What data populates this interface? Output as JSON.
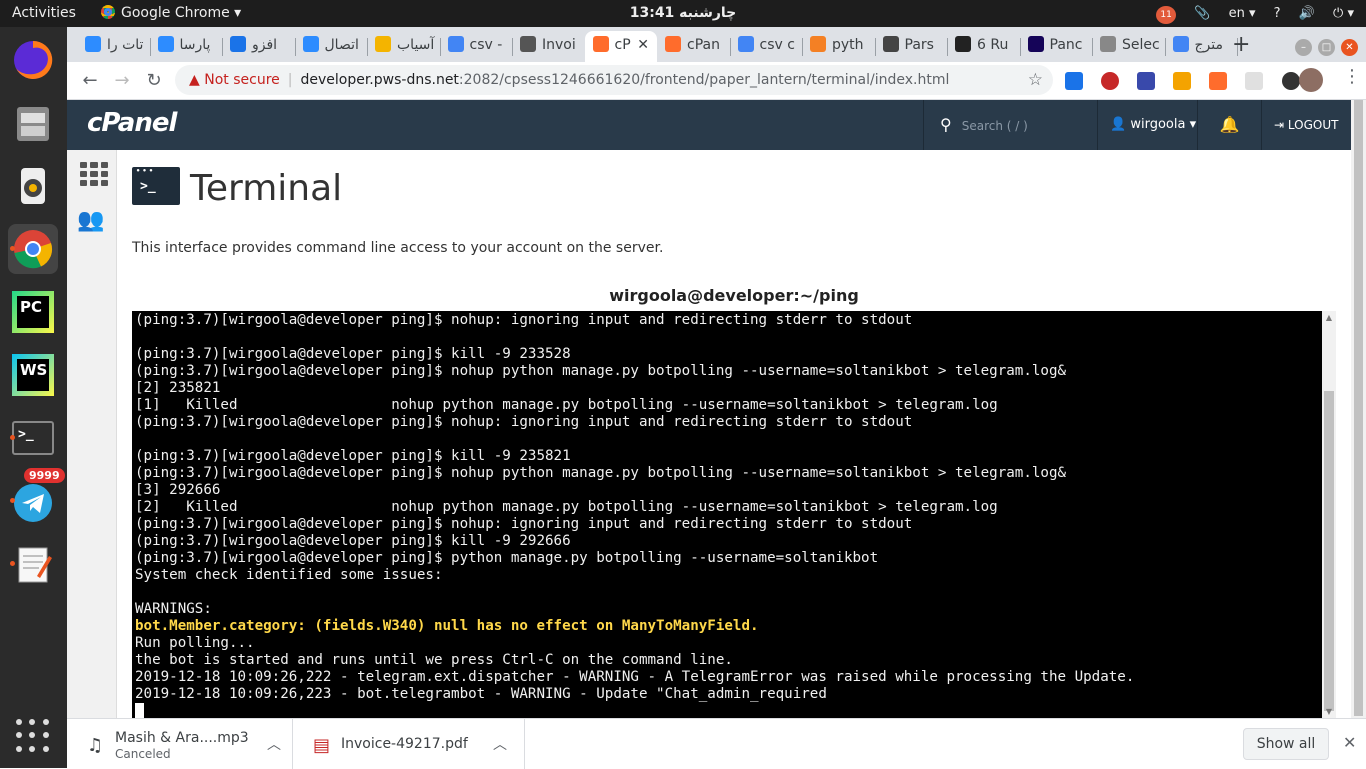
{
  "topbar": {
    "activities": "Activities",
    "app_menu": "Google Chrome",
    "clock": "13:41 چارشنبه",
    "notif_badge": "11",
    "lang": "en",
    "help": "?",
    "sound": "🔊",
    "power": "⏻"
  },
  "dock": {
    "apps": [
      "firefox-icon",
      "files-icon",
      "rhythmbox-icon",
      "chrome-icon",
      "pycharm-icon",
      "webstorm-icon",
      "terminal-icon",
      "telegram-icon",
      "text-editor-icon"
    ],
    "pycharm_label": "PC",
    "webstorm_label": "WS",
    "terminal_label": ">_",
    "telegram_badge": "9999"
  },
  "tabs": [
    {
      "label": "تات را",
      "icon": "cloud-icon",
      "color": "#2d8cff"
    },
    {
      "label": "پارسا",
      "icon": "cloud-icon",
      "color": "#2d8cff"
    },
    {
      "label": "افزو",
      "icon": "shield-icon",
      "color": "#1a73e8"
    },
    {
      "label": "اتصال",
      "icon": "cloud-icon",
      "color": "#2d8cff"
    },
    {
      "label": "آسیاب",
      "icon": "x-icon",
      "color": "#f4b400"
    },
    {
      "label": "csv -",
      "icon": "google-icon",
      "color": "#4285f4"
    },
    {
      "label": "Invoi",
      "icon": "doc-icon",
      "color": "#555555"
    },
    {
      "label": "cP",
      "icon": "cpanel-icon",
      "color": "#ff6c2c",
      "active": true
    },
    {
      "label": "cPan",
      "icon": "cpanel-icon",
      "color": "#ff6c2c"
    },
    {
      "label": "csv c",
      "icon": "google-icon",
      "color": "#4285f4"
    },
    {
      "label": "pyth",
      "icon": "bookmark-icon",
      "color": "#f48024"
    },
    {
      "label": "Pars",
      "icon": "rg-icon",
      "color": "#444444"
    },
    {
      "label": "6 Ru",
      "icon": "medium-icon",
      "color": "#222222"
    },
    {
      "label": "Panc",
      "icon": "pandas-icon",
      "color": "#150458"
    },
    {
      "label": "Selec",
      "icon": "doc-icon",
      "color": "#888888"
    },
    {
      "label": "مترج",
      "icon": "translate-icon",
      "color": "#4285f4"
    }
  ],
  "address": {
    "not_secure": "Not secure",
    "host": "developer.pws-dns.net",
    "rest": ":2082/cpsess1246661620/frontend/paper_lantern/terminal/index.html"
  },
  "cpanel": {
    "logo": "cPanel",
    "search_placeholder": "Search ( / )",
    "user": "wirgoola",
    "logout": "LOGOUT"
  },
  "page": {
    "title": "Terminal",
    "description": "This interface provides command line access to your account on the server.",
    "terminal_title": "wirgoola@developer:~/ping"
  },
  "terminal": {
    "lines": [
      "(ping:3.7)[wirgoola@developer ping]$ nohup: ignoring input and redirecting stderr to stdout",
      "",
      "(ping:3.7)[wirgoola@developer ping]$ kill -9 233528",
      "(ping:3.7)[wirgoola@developer ping]$ nohup python manage.py botpolling --username=soltanikbot > telegram.log&",
      "[2] 235821",
      "[1]   Killed                  nohup python manage.py botpolling --username=soltanikbot > telegram.log",
      "(ping:3.7)[wirgoola@developer ping]$ nohup: ignoring input and redirecting stderr to stdout",
      "",
      "(ping:3.7)[wirgoola@developer ping]$ kill -9 235821",
      "(ping:3.7)[wirgoola@developer ping]$ nohup python manage.py botpolling --username=soltanikbot > telegram.log&",
      "[3] 292666",
      "[2]   Killed                  nohup python manage.py botpolling --username=soltanikbot > telegram.log",
      "(ping:3.7)[wirgoola@developer ping]$ nohup: ignoring input and redirecting stderr to stdout",
      "(ping:3.7)[wirgoola@developer ping]$ kill -9 292666",
      "(ping:3.7)[wirgoola@developer ping]$ python manage.py botpolling --username=soltanikbot",
      "System check identified some issues:",
      "",
      "WARNINGS:",
      "bot.Member.category: (fields.W340) null has no effect on ManyToManyField.",
      "Run polling...",
      "the bot is started and runs until we press Ctrl-C on the command line.",
      "2019-12-18 10:09:26,222 - telegram.ext.dispatcher - WARNING - A TelegramError was raised while processing the Update.",
      "2019-12-18 10:09:26,223 - bot.telegrambot - WARNING - Update \"Chat_admin_required"
    ],
    "warning_line_index": 18,
    "warning_color": "#ffd84a"
  },
  "downloads": {
    "items": [
      {
        "name": "Masih & Ara....mp3",
        "status": "Canceled",
        "icon": "music-note-icon"
      },
      {
        "name": "Invoice-49217.pdf",
        "status": "",
        "icon": "pdf-icon"
      }
    ],
    "show_all": "Show all"
  }
}
